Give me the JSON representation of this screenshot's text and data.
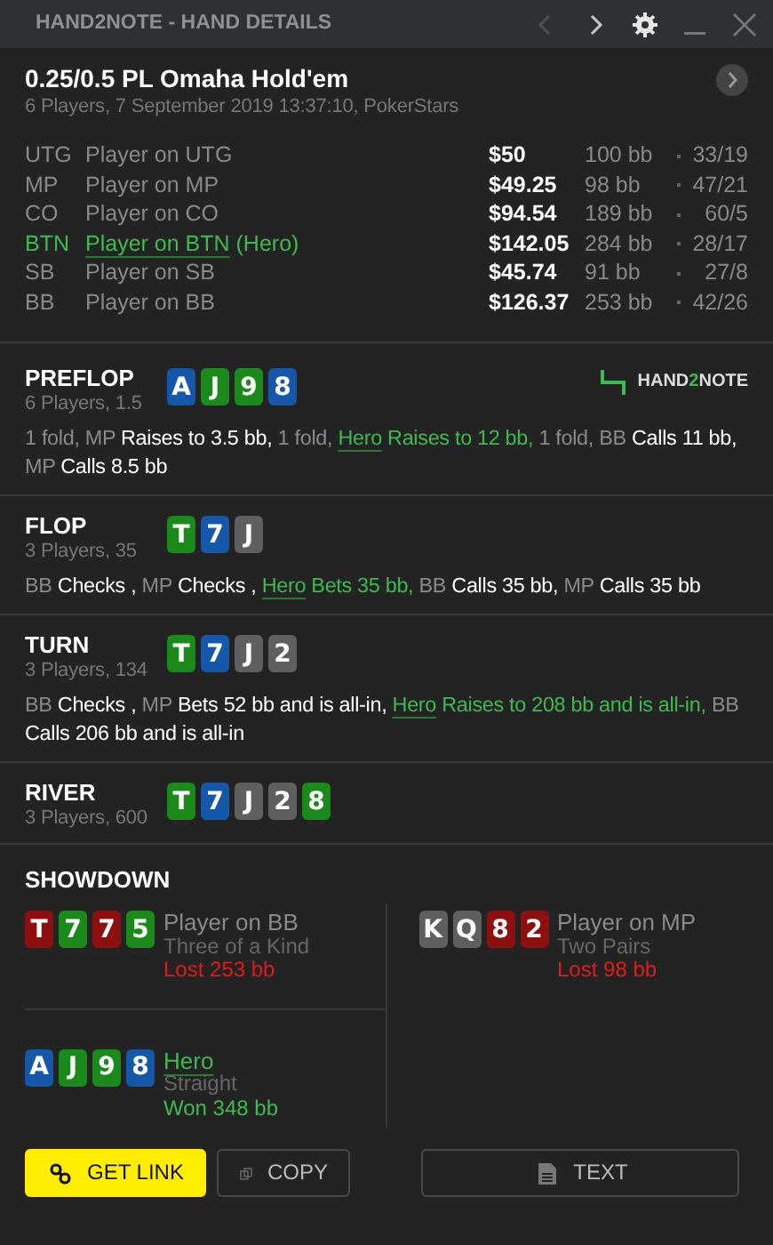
{
  "window": {
    "title": "HAND2NOTE - HAND DETAILS"
  },
  "hand": {
    "title": "0.25/0.5 PL Omaha Hold'em",
    "subtitle": "6 Players, 7 September 2019 13:37:10, PokerStars"
  },
  "players": [
    {
      "position": "UTG",
      "name": "Player on UTG",
      "hero": false,
      "stack": "$50",
      "bb": "100 bb",
      "stats": "33/19"
    },
    {
      "position": "MP",
      "name": "Player on MP",
      "hero": false,
      "stack": "$49.25",
      "bb": "98 bb",
      "stats": "47/21"
    },
    {
      "position": "CO",
      "name": "Player on CO",
      "hero": false,
      "stack": "$94.54",
      "bb": "189 bb",
      "stats": "60/5"
    },
    {
      "position": "BTN",
      "name": "Player on BTN",
      "hero": true,
      "hero_tag": "(Hero)",
      "stack": "$142.05",
      "bb": "284 bb",
      "stats": "28/17"
    },
    {
      "position": "SB",
      "name": "Player on SB",
      "hero": false,
      "stack": "$45.74",
      "bb": "91 bb",
      "stats": "27/8"
    },
    {
      "position": "BB",
      "name": "Player on BB",
      "hero": false,
      "stack": "$126.37",
      "bb": "253 bb",
      "stats": "42/26"
    }
  ],
  "logo": {
    "parts": [
      "HAND",
      "2",
      "NOTE"
    ]
  },
  "streets": [
    {
      "name": "PREFLOP",
      "info": "6 Players, 1.5",
      "logo": true,
      "cards": [
        {
          "rank": "A",
          "color": "#1557a8"
        },
        {
          "rank": "J",
          "color": "#1a8a1a"
        },
        {
          "rank": "9",
          "color": "#1a8a1a"
        },
        {
          "rank": "8",
          "color": "#1557a8"
        }
      ],
      "actions": [
        {
          "text": "1 fold, MP",
          "kind": "actor"
        },
        {
          "text": "Raises to 3.5 bb,",
          "kind": "action"
        },
        {
          "text": "1 fold,",
          "kind": "actor"
        },
        {
          "text": "Hero",
          "kind": "hero"
        },
        {
          "text": "Raises to 12 bb,",
          "kind": "hero-action"
        },
        {
          "text": "1 fold, BB",
          "kind": "actor"
        },
        {
          "text": "Calls 11 bb,",
          "kind": "action"
        },
        {
          "text": "MP",
          "kind": "actor"
        },
        {
          "text": "Calls 8.5 bb",
          "kind": "action"
        }
      ]
    },
    {
      "name": "FLOP",
      "info": "3 Players, 35",
      "logo": false,
      "cards": [
        {
          "rank": "T",
          "color": "#1a8a1a"
        },
        {
          "rank": "7",
          "color": "#1557a8"
        },
        {
          "rank": "J",
          "color": "#5f5f5f"
        }
      ],
      "actions": [
        {
          "text": "BB",
          "kind": "actor"
        },
        {
          "text": "Checks ,",
          "kind": "action"
        },
        {
          "text": "MP",
          "kind": "actor"
        },
        {
          "text": "Checks ,",
          "kind": "action"
        },
        {
          "text": "Hero",
          "kind": "hero"
        },
        {
          "text": "Bets 35 bb,",
          "kind": "hero-action"
        },
        {
          "text": "BB",
          "kind": "actor"
        },
        {
          "text": "Calls 35 bb,",
          "kind": "action"
        },
        {
          "text": "MP",
          "kind": "actor"
        },
        {
          "text": "Calls 35 bb",
          "kind": "action"
        }
      ]
    },
    {
      "name": "TURN",
      "info": "3 Players, 134",
      "logo": false,
      "cards": [
        {
          "rank": "T",
          "color": "#1a8a1a"
        },
        {
          "rank": "7",
          "color": "#1557a8"
        },
        {
          "rank": "J",
          "color": "#5f5f5f"
        },
        {
          "rank": "2",
          "color": "#5f5f5f"
        }
      ],
      "actions": [
        {
          "text": "BB",
          "kind": "actor"
        },
        {
          "text": "Checks ,",
          "kind": "action"
        },
        {
          "text": "MP",
          "kind": "actor"
        },
        {
          "text": "Bets 52 bb and is all-in,",
          "kind": "action"
        },
        {
          "text": "Hero",
          "kind": "hero"
        },
        {
          "text": "Raises to 208 bb and is all-in,",
          "kind": "hero-action"
        },
        {
          "text": "BB",
          "kind": "actor"
        },
        {
          "text": "Calls 206 bb and is all-in",
          "kind": "action"
        }
      ]
    },
    {
      "name": "RIVER",
      "info": "3 Players, 600",
      "logo": false,
      "cards": [
        {
          "rank": "T",
          "color": "#1a8a1a"
        },
        {
          "rank": "7",
          "color": "#1557a8"
        },
        {
          "rank": "J",
          "color": "#5f5f5f"
        },
        {
          "rank": "2",
          "color": "#5f5f5f"
        },
        {
          "rank": "8",
          "color": "#1a8a1a"
        }
      ]
    }
  ],
  "showdown": {
    "title": "SHOWDOWN",
    "entries": [
      {
        "name": "Player on BB",
        "hero": false,
        "hand": "Three of a Kind",
        "result": "Lost 253 bb",
        "won": false,
        "cards": [
          {
            "rank": "T",
            "color": "#8e0f0f"
          },
          {
            "rank": "7",
            "color": "#1a8a1a"
          },
          {
            "rank": "7",
            "color": "#8e0f0f"
          },
          {
            "rank": "5",
            "color": "#1a8a1a"
          }
        ]
      },
      {
        "name": "Player on MP",
        "hero": false,
        "hand": "Two Pairs",
        "result": "Lost 98 bb",
        "won": false,
        "cards": [
          {
            "rank": "K",
            "color": "#5f5f5f"
          },
          {
            "rank": "Q",
            "color": "#5f5f5f"
          },
          {
            "rank": "8",
            "color": "#8e0f0f"
          },
          {
            "rank": "2",
            "color": "#8e0f0f"
          }
        ]
      },
      {
        "name": "Hero",
        "hero": true,
        "hand": "Straight",
        "result": "Won 348 bb",
        "won": true,
        "cards": [
          {
            "rank": "A",
            "color": "#1557a8"
          },
          {
            "rank": "J",
            "color": "#1a8a1a"
          },
          {
            "rank": "9",
            "color": "#1a8a1a"
          },
          {
            "rank": "8",
            "color": "#1557a8"
          }
        ]
      }
    ]
  },
  "buttons": [
    {
      "label": "GET LINK",
      "kind": "link"
    },
    {
      "label": "COPY",
      "kind": "copy"
    },
    {
      "label": "TEXT",
      "kind": "text"
    }
  ]
}
